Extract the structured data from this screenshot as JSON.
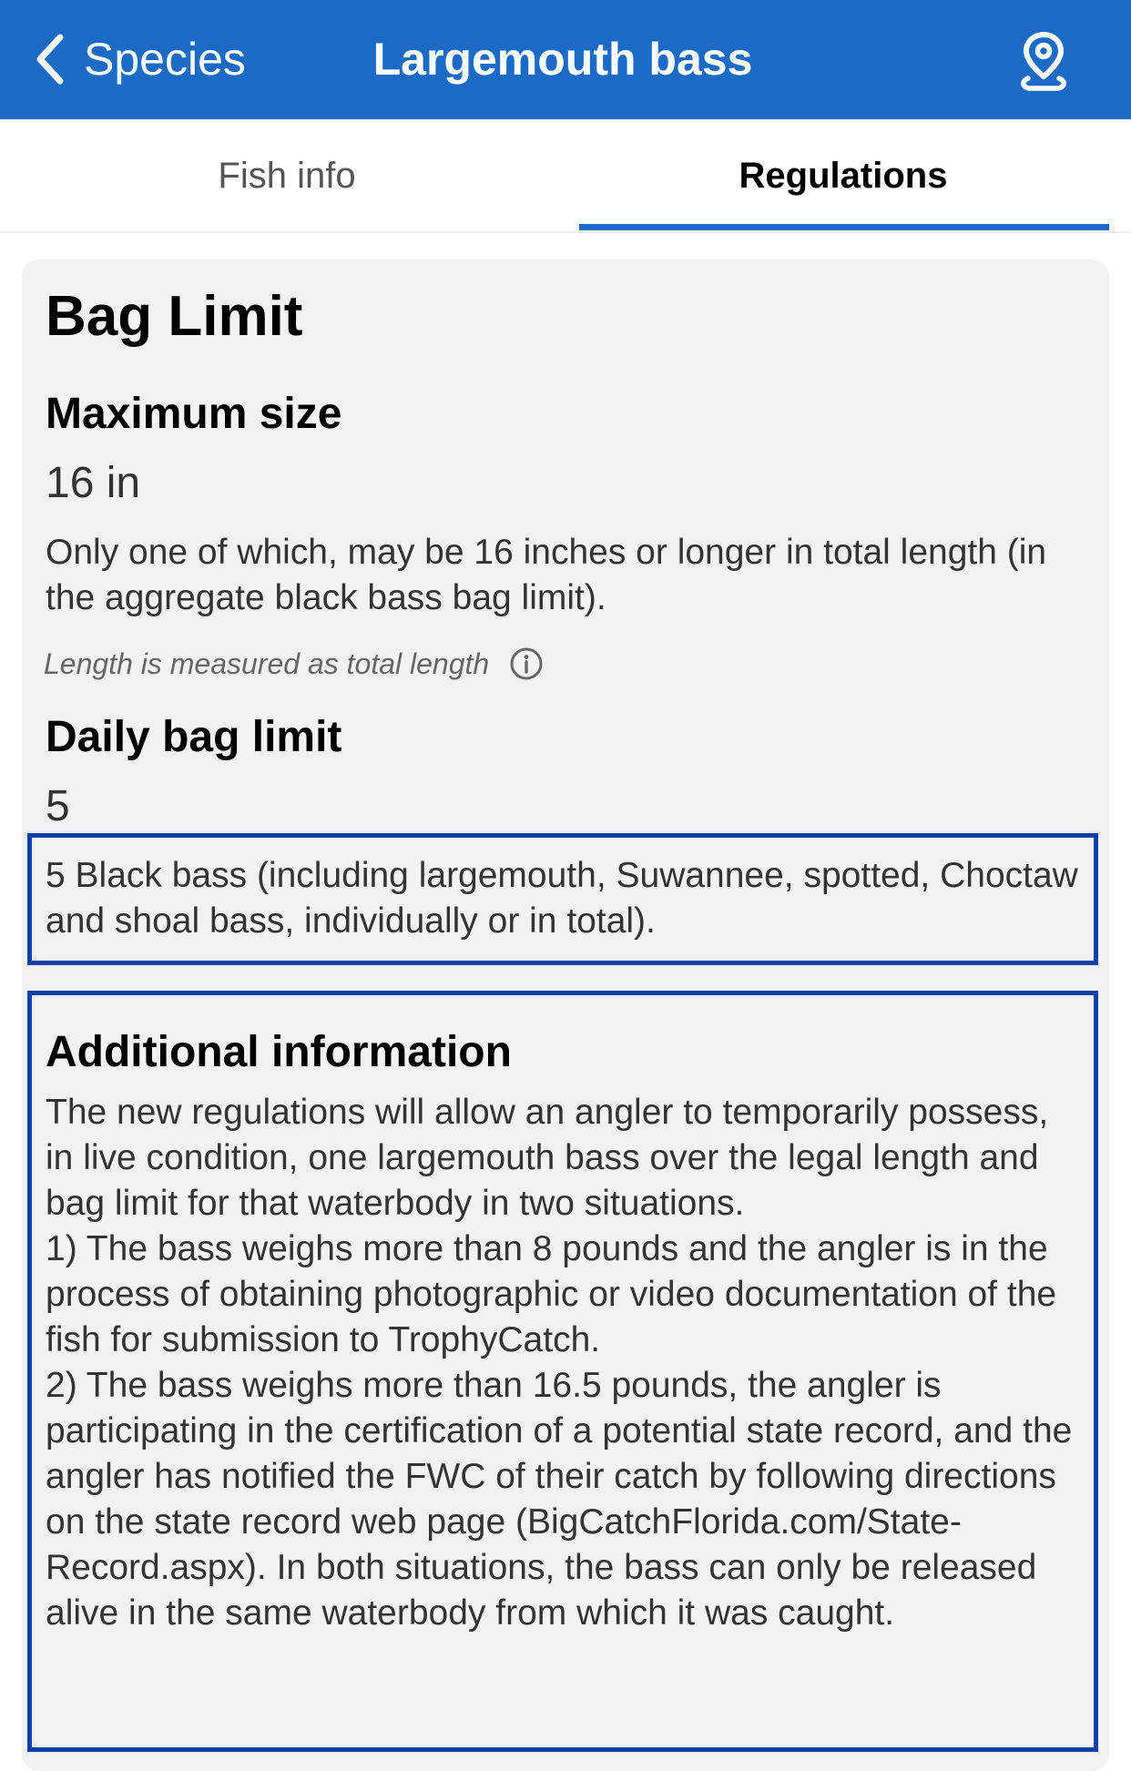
{
  "nav": {
    "back_label": "Species",
    "title": "Largemouth bass"
  },
  "tabs": [
    {
      "label": "Fish info",
      "active": false
    },
    {
      "label": "Regulations",
      "active": true
    }
  ],
  "icons": {
    "back": "chevron-left-icon",
    "location": "map-pin-icon",
    "info": "info-circle-icon"
  },
  "colors": {
    "nav_bg": "#1b6bc6",
    "tab_indicator": "#1b6bc6",
    "highlight_border": "#0a3ea8",
    "card_bg": "#f2f2f2"
  },
  "regulations": {
    "heading": "Bag Limit",
    "max_size": {
      "label": "Maximum size",
      "value": "16 in",
      "description": "Only one of which, may be 16 inches or longer in total length (in the aggregate black bass bag limit).",
      "note": "Length is measured as total length"
    },
    "daily_bag": {
      "label": "Daily bag limit",
      "value": "5",
      "description": "5 Black bass (including largemouth, Suwannee, spotted, Choctaw and shoal bass, individually or in total)."
    },
    "additional": {
      "label": "Additional information",
      "paragraphs": [
        "The new regulations will allow an angler to temporarily possess, in live condition, one largemouth bass over the legal length and bag limit for that waterbody in two situations.",
        "1) The bass weighs more than 8 pounds and the angler is in the process of obtaining photographic or video documentation of the fish for submission to TrophyCatch.",
        "2) The bass weighs more than 16.5 pounds, the angler is participating in the certification of a potential state record, and the angler has notified the FWC of their catch by following directions on the state record web page (BigCatchFlorida.com/State-Record.aspx). In both situations, the bass can only be released alive in the same waterbody from which it was caught."
      ]
    }
  }
}
